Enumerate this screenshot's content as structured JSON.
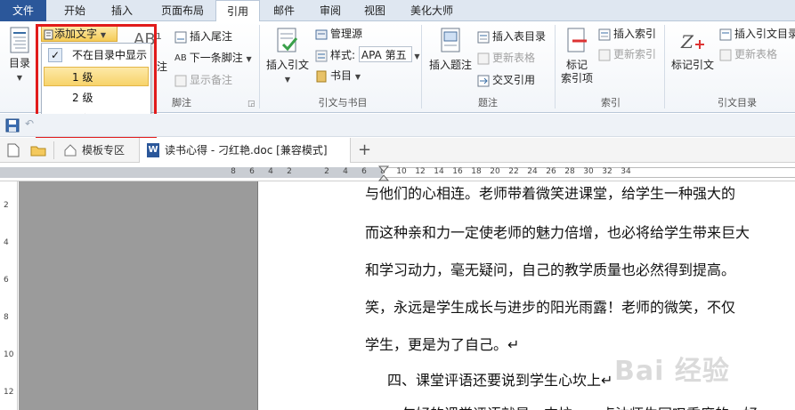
{
  "tabs": [
    {
      "label": "文件"
    },
    {
      "label": "开始"
    },
    {
      "label": "插入"
    },
    {
      "label": "页面布局"
    },
    {
      "label": "引用"
    },
    {
      "label": "邮件"
    },
    {
      "label": "审阅"
    },
    {
      "label": "视图"
    },
    {
      "label": "美化大师"
    }
  ],
  "ribbon": {
    "toc": {
      "label": "目录",
      "add_text": "添加文字"
    },
    "footnote": {
      "label_partial": "注",
      "insert_endnote": "插入尾注",
      "next_footnote": "下一条脚注",
      "show_notes": "显示备注",
      "group": "脚注"
    },
    "citations": {
      "insert_citation": "插入引文",
      "manage_sources": "管理源",
      "style_label": "样式:",
      "style_value": "APA 第五",
      "bibliography": "书目",
      "group": "引文与书目"
    },
    "captions": {
      "insert_caption": "插入题注",
      "insert_table_of_figures": "插入表目录",
      "update_table": "更新表格",
      "cross_reference": "交叉引用",
      "group": "题注"
    },
    "index": {
      "mark_entry_line1": "标记",
      "mark_entry_line2": "索引项",
      "insert_index": "插入索引",
      "update_index": "更新索引",
      "group": "索引"
    },
    "authorities": {
      "mark_citation": "标记引文",
      "insert_toa": "插入引文目录",
      "update_table": "更新表格",
      "group": "引文目录"
    }
  },
  "dropdown": {
    "items": [
      {
        "label": "不在目录中显示",
        "checked": true
      },
      {
        "label": "1 级",
        "highlighted": true
      },
      {
        "label": "2 级"
      },
      {
        "label": "3 级"
      }
    ]
  },
  "doc_tabs": {
    "template_zone": "模板专区",
    "doc_title": "读书心得 - 刁红艳.doc [兼容模式]",
    "add": "+"
  },
  "ruler": {
    "h_ticks": [
      "8",
      "6",
      "4",
      "2",
      "",
      "2",
      "4",
      "6",
      "8",
      "10",
      "12",
      "14",
      "16",
      "18",
      "20",
      "22",
      "24",
      "26",
      "28",
      "30",
      "32",
      "34"
    ],
    "v_ticks": [
      "2",
      "4",
      "6",
      "8",
      "10",
      "12"
    ]
  },
  "document": {
    "lines": [
      "与他们的心相连。老师带着微笑进课堂，给学生一种强大的",
      "而这种亲和力一定使老师的魅力倍增，也必将给学生带来巨大",
      "和学习动力，毫无疑问，自己的教学质量也必然得到提高。",
      "笑，永远是学生成长与进步的阳光雨露！老师的微笑，不仅",
      "学生，更是为了自己。↵",
      "四、课堂评语还要说到学生心坎上↵",
      "一句好的课堂评语就是一支拉，一点油师生同叹重度的，好"
    ]
  },
  "watermark": "Bai 经验",
  "colors": {
    "file_tab": "#2b579a",
    "highlight": "#f7d36a",
    "red_box": "#e11b1b"
  }
}
